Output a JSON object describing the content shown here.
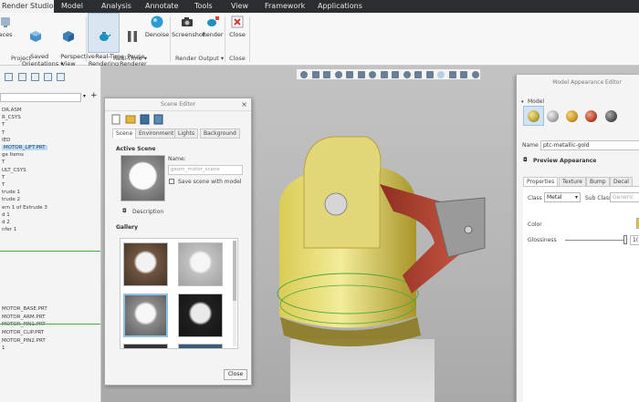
{
  "menubar": {
    "active_tab": "Render Studio",
    "items": [
      "Model",
      "Analysis",
      "Annotate",
      "Tools",
      "View",
      "Framework",
      "Applications"
    ]
  },
  "ribbon": {
    "buttons": [
      {
        "label": "aces",
        "icon": "device-icon"
      },
      {
        "label": "Saved\nOrientations ▾",
        "icon": "orientations-icon"
      },
      {
        "label": "Perspective\nView",
        "icon": "perspective-cube-icon"
      },
      {
        "label": "Real-Time\nRendering",
        "icon": "teapot-icon"
      },
      {
        "label": "Pause\nRenderer",
        "icon": "pause-icon"
      },
      {
        "label": "Denoise",
        "icon": "sphere-icon"
      },
      {
        "label": "Screenshot",
        "icon": "camera-icon"
      },
      {
        "label": "Render",
        "icon": "render-teapot-icon"
      },
      {
        "label": "Close",
        "icon": "close-icon"
      }
    ],
    "groups": [
      "Project",
      "Real-Time ▾",
      "Render Output ▾",
      "Close"
    ]
  },
  "tree": {
    "items": [
      {
        "label": "DR.ASM",
        "selected": false
      },
      {
        "label": "R_CSYS",
        "selected": false
      },
      {
        "label": "T",
        "selected": false
      },
      {
        "label": "T",
        "selected": false
      },
      {
        "label": "IED",
        "selected": false
      },
      {
        "label": "MOTOR_LIFT.PRT",
        "selected": true
      },
      {
        "label": "ge Items",
        "selected": false
      },
      {
        "label": "T",
        "selected": false
      },
      {
        "label": "ULT_CSYS",
        "selected": false
      },
      {
        "label": "T",
        "selected": false
      },
      {
        "label": "T",
        "selected": false
      },
      {
        "label": "trude 1",
        "selected": false
      },
      {
        "label": "trude 2",
        "selected": false
      },
      {
        "label": "ern 1 of Extrude 3",
        "selected": false
      },
      {
        "label": "d 1",
        "selected": false
      },
      {
        "label": "d 2",
        "selected": false
      },
      {
        "label": "nfer 1",
        "selected": false
      },
      {
        "label": "MOTOR_BASE.PRT",
        "selected": false
      },
      {
        "label": "MOTOR_ARM.PRT",
        "selected": false
      },
      {
        "label": "MOTOR_PIN1.PRT",
        "selected": false
      },
      {
        "label": "MOTOR_CLIP.PRT",
        "selected": false
      },
      {
        "label": "MOTOR_PIN2.PRT",
        "selected": false
      },
      {
        "label": "1",
        "selected": false
      }
    ]
  },
  "scene_editor": {
    "title": "Scene Editor",
    "tabs": [
      "Scene",
      "Environment",
      "Lights",
      "Background"
    ],
    "active_scene_label": "Active Scene",
    "name_label": "Name:",
    "name_placeholder": "geom_motor_scene",
    "save_with_model": "Save scene with model",
    "description": "Description",
    "gallery_label": "Gallery",
    "close": "Close"
  },
  "appearance_editor": {
    "title": "Model Appearance Editor",
    "model_label": "Model",
    "swatch_colors": [
      "#b9a33a",
      "#a9a9a9",
      "#c9982a",
      "#b8472f",
      "#555555"
    ],
    "name_label": "Name",
    "name_value": "ptc-metallic-gold",
    "preview_label": "Preview Appearance",
    "tabs": [
      "Properties",
      "Texture",
      "Bump",
      "Decal"
    ],
    "class_label": "Class",
    "class_value": "Metal",
    "subclass_label": "Sub Class",
    "subclass_value": "Generic",
    "color_label": "Color",
    "glossiness_label": "Glossiness",
    "glossiness_value": "1("
  }
}
